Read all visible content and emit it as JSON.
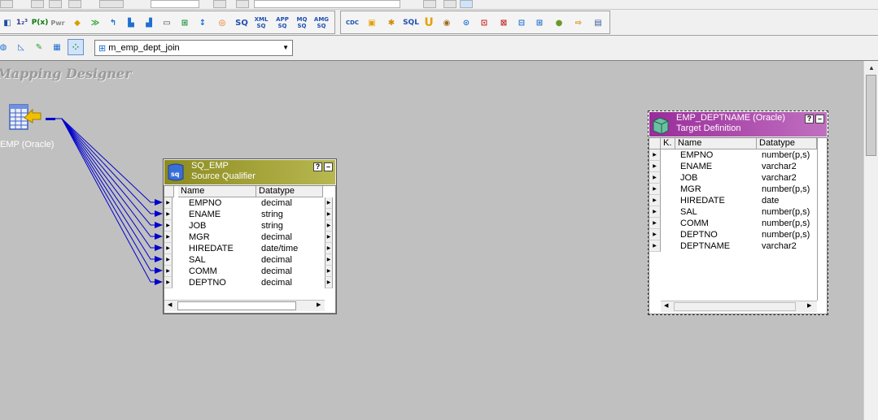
{
  "toolbar": {
    "mapping_selector": {
      "value": "m_emp_dept_join"
    },
    "buttons_row2": [
      "1₂³",
      "P(x)",
      "Pwr",
      "SQ",
      "XML SQ",
      "APP SQ",
      "MQ SQ",
      "AMG SQ",
      "CDC",
      "SQL"
    ],
    "labels": {
      "sq": "SQ",
      "xml": "XML",
      "app": "APP",
      "mq": "MQ",
      "amg": "AMG",
      "cdc": "CDC",
      "sql": "SQL",
      "p": "P(x)",
      "num": "1₂³",
      "pwr": "Pwr",
      "sq_small": "SQ"
    }
  },
  "workspace": {
    "title": "Mapping Designer",
    "source_icon_label": "EMP (Oracle)"
  },
  "source_qualifier": {
    "name": "SQ_EMP",
    "subtitle": "Source Qualifier",
    "columns": {
      "name": "Name",
      "datatype": "Datatype"
    },
    "rows": [
      {
        "name": "EMPNO",
        "datatype": "decimal"
      },
      {
        "name": "ENAME",
        "datatype": "string"
      },
      {
        "name": "JOB",
        "datatype": "string"
      },
      {
        "name": "MGR",
        "datatype": "decimal"
      },
      {
        "name": "HIREDATE",
        "datatype": "date/time"
      },
      {
        "name": "SAL",
        "datatype": "decimal"
      },
      {
        "name": "COMM",
        "datatype": "decimal"
      },
      {
        "name": "DEPTNO",
        "datatype": "decimal"
      }
    ],
    "header_color": "#8b8b20"
  },
  "target": {
    "name": "EMP_DEPTNAME (Oracle)",
    "subtitle": "Target Definition",
    "columns": {
      "key": "K.",
      "name": "Name",
      "datatype": "Datatype"
    },
    "rows": [
      {
        "name": "EMPNO",
        "datatype": "number(p,s)"
      },
      {
        "name": "ENAME",
        "datatype": "varchar2"
      },
      {
        "name": "JOB",
        "datatype": "varchar2"
      },
      {
        "name": "MGR",
        "datatype": "number(p,s)"
      },
      {
        "name": "HIREDATE",
        "datatype": "date"
      },
      {
        "name": "SAL",
        "datatype": "number(p,s)"
      },
      {
        "name": "COMM",
        "datatype": "number(p,s)"
      },
      {
        "name": "DEPTNO",
        "datatype": "number(p,s)"
      },
      {
        "name": "DEPTNAME",
        "datatype": "varchar2"
      }
    ],
    "header_color": "#9a2c9a"
  },
  "link_color": "#0000cc",
  "window_buttons": {
    "help": "?",
    "minimize": "–"
  }
}
